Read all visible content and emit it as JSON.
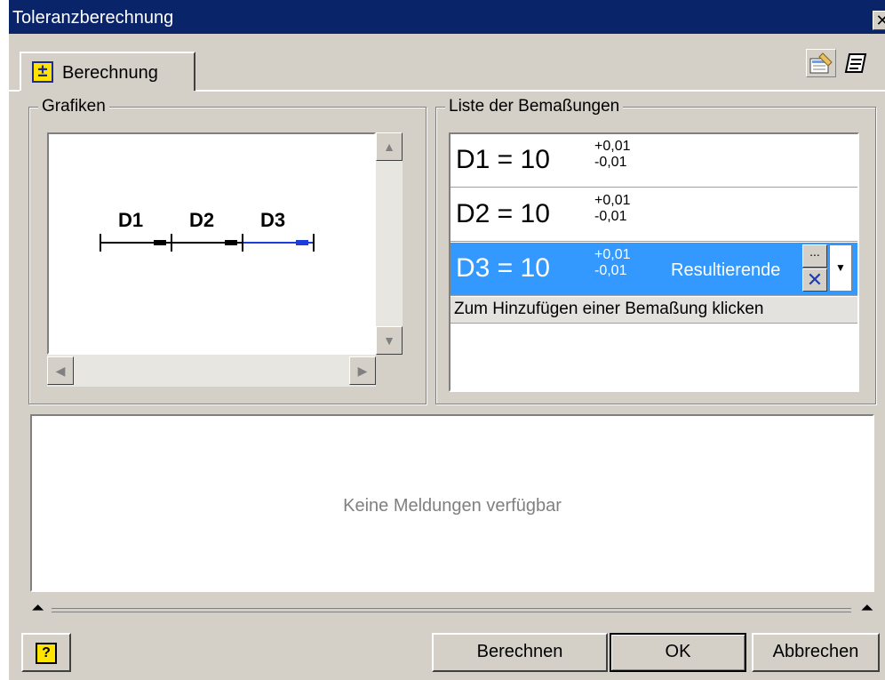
{
  "window": {
    "title": "Toleranzberechnung",
    "close_glyph": "✕"
  },
  "tabs": [
    {
      "label": "Berechnung",
      "icon": "plus-minus-icon",
      "icon_glyph": "±"
    }
  ],
  "toolbar": {
    "icons": [
      "properties-icon",
      "notes-icon"
    ]
  },
  "graphics": {
    "group_label": "Grafiken",
    "dimension_labels": [
      "D1",
      "D2",
      "D3"
    ]
  },
  "dimension_list": {
    "group_label": "Liste der Bemaßungen",
    "rows": [
      {
        "formula": "D1 = 10",
        "upper": "+0,01",
        "lower": "-0,01"
      },
      {
        "formula": "D2 = 10",
        "upper": "+0,01",
        "lower": "-0,01"
      },
      {
        "formula": "D3 = 10",
        "upper": "+0,01",
        "lower": "-0,01",
        "status": "Resultierende",
        "more_label": "...",
        "delete_glyph": "✕",
        "dropdown_glyph": "▼"
      }
    ],
    "add_row_text": "Zum Hinzufügen einer Bemaßung klicken",
    "selected_color": "#3399ff"
  },
  "messages": {
    "text": "Keine Meldungen verfügbar"
  },
  "splitter": {
    "glyph": "⏶"
  },
  "buttons": {
    "help_glyph": "?",
    "calculate": "Berechnen",
    "ok": "OK",
    "cancel": "Abbrechen"
  },
  "colors": {
    "title_bar": "#0a246a",
    "dialog_bg": "#d4d0c8",
    "accent": "#3399ff",
    "d3_line": "#1e3cdc"
  }
}
